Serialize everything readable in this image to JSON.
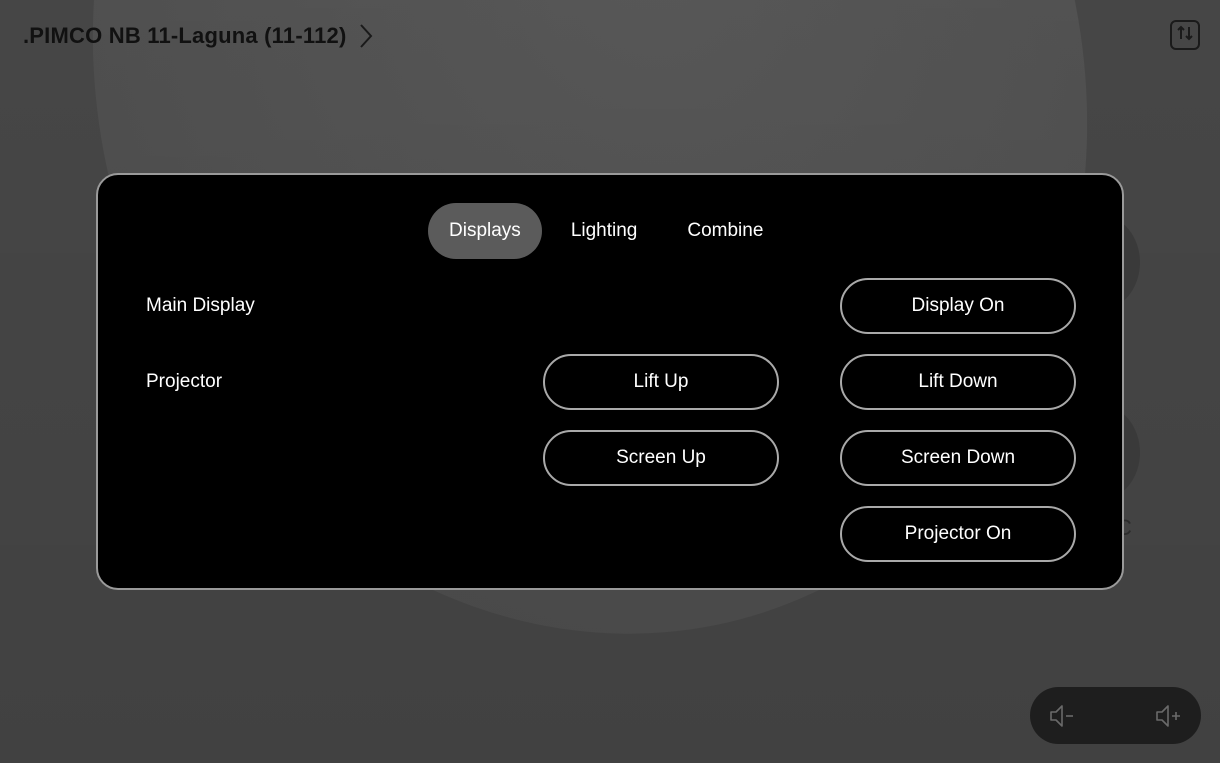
{
  "header": {
    "room_name": ".PIMCO NB 11-Laguna (11-112)"
  },
  "icons": {
    "room_chevron": "chevron-right-icon",
    "settings": "sliders-icon",
    "volume_down": "speaker-minus-icon",
    "volume_up": "speaker-plus-icon"
  },
  "panel": {
    "tabs": [
      {
        "label": "Displays",
        "active": true
      },
      {
        "label": "Lighting",
        "active": false
      },
      {
        "label": "Combine",
        "active": false
      }
    ],
    "rows": [
      {
        "label": "Main Display"
      },
      {
        "label": "Projector"
      }
    ],
    "buttons": {
      "display_on": "Display On",
      "lift_up": "Lift Up",
      "lift_down": "Lift Down",
      "screen_up": "Screen Up",
      "screen_down": "Screen Down",
      "projector_on": "Projector On"
    }
  },
  "background": {
    "partial_label": "C"
  },
  "colors": {
    "background": "#4a4a4a",
    "panel": "#000000",
    "active_tab": "#5b5b5b",
    "button_border": "#a9a9a9"
  }
}
